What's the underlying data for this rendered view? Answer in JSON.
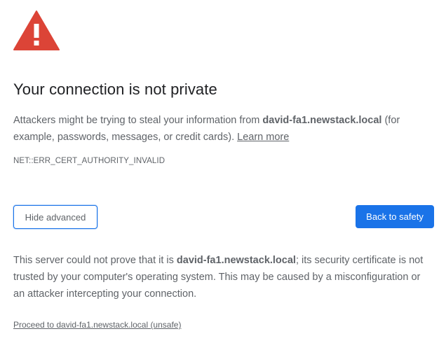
{
  "icon": "warning-triangle-icon",
  "colors": {
    "warning_red": "#dc4437",
    "primary_blue": "#1a73e8",
    "text_dark": "#202124",
    "text_muted": "#5f6368"
  },
  "heading": "Your connection is not private",
  "description": {
    "prefix": "Attackers might be trying to steal your information from ",
    "host": "david-fa1.newstack.local",
    "suffix": " (for example, passwords, messages, or credit cards). ",
    "learn_more": "Learn more"
  },
  "error_code": "NET::ERR_CERT_AUTHORITY_INVALID",
  "buttons": {
    "hide_advanced": "Hide advanced",
    "back_to_safety": "Back to safety"
  },
  "details": {
    "prefix": "This server could not prove that it is ",
    "host": "david-fa1.newstack.local",
    "suffix": "; its security certificate is not trusted by your computer's operating system. This may be caused by a misconfiguration or an attacker intercepting your connection."
  },
  "proceed_link": "Proceed to david-fa1.newstack.local (unsafe)"
}
